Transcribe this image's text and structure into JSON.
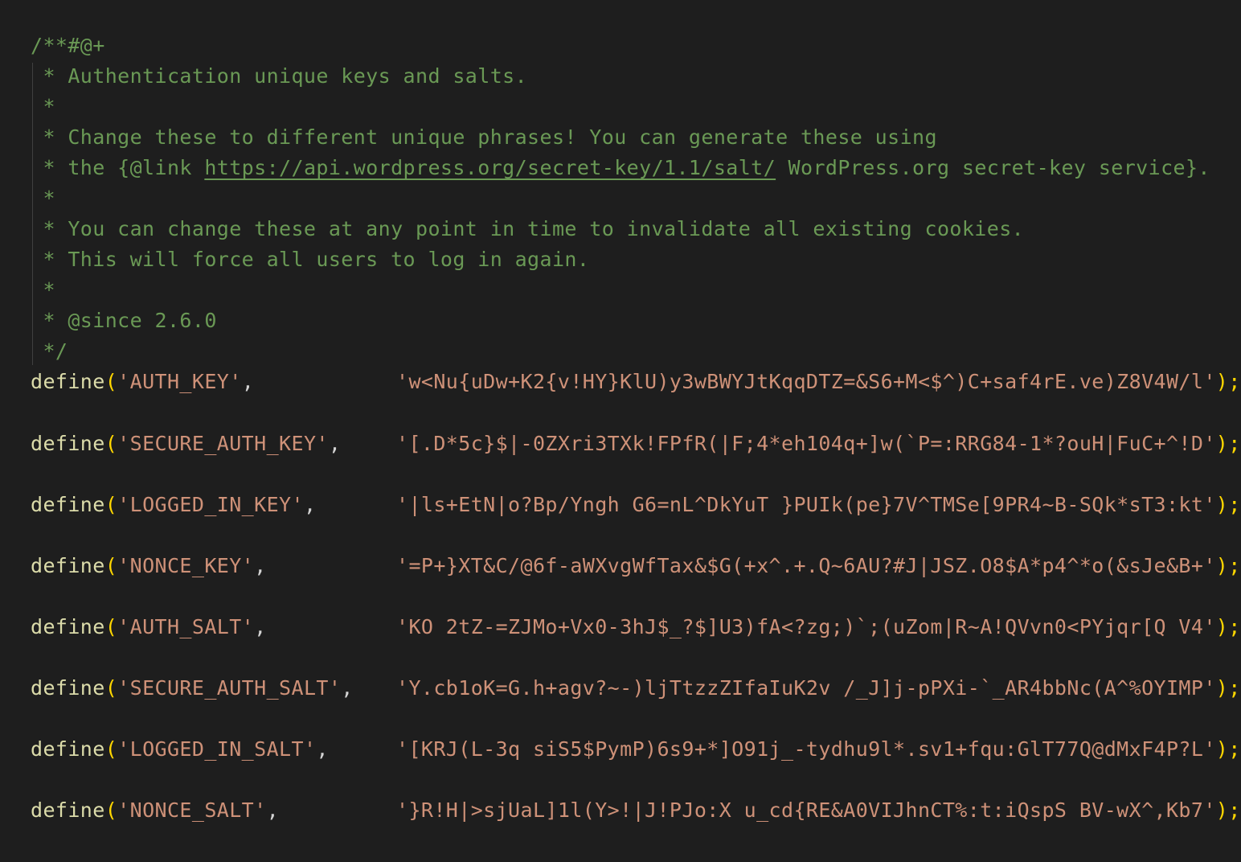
{
  "comment": {
    "open": "/**#@+",
    "title": " * Authentication unique keys and salts.",
    "blank1": " *",
    "change_a": " * Change these to different unique phrases! You can generate these using",
    "link_prefix": " * the {@link ",
    "link_url": "https://api.wordpress.org/secret-key/1.1/salt/",
    "link_suffix": " WordPress.org secret-key service}.",
    "blank2": " *",
    "invalidate": " * You can change these at any point in time to invalidate all existing cookies.",
    "force": " * This will force all users to log in again.",
    "blank3": " *",
    "since": " * @since 2.6.0",
    "close": " */"
  },
  "defines": [
    {
      "fn": "define",
      "key": "'AUTH_KEY'",
      "value": "'w<Nu{uDw+K2{v!HY}KlU)y3wBWYJtKqqDTZ=&S6+M<$^)C+saf4rE.ve)Z8V4W/l'"
    },
    {
      "fn": "define",
      "key": "'SECURE_AUTH_KEY'",
      "value": "'[.D*5c}$|-0ZXri3TXk!FPfR(|F;4*eh104q+]w(`P=:RRG84-1*?ouH|FuC+^!D'"
    },
    {
      "fn": "define",
      "key": "'LOGGED_IN_KEY'",
      "value": "'|ls+EtN|o?Bp/Yngh G6=nL^DkYuT }PUIk(pe}7V^TMSe[9PR4~B-SQk*sT3:kt'"
    },
    {
      "fn": "define",
      "key": "'NONCE_KEY'",
      "value": "'=P+}XT&C/@6f-aWXvgWfTax&$G(+x^.+.Q~6AU?#J|JSZ.O8$A*p4^*o(&sJe&B+'"
    },
    {
      "fn": "define",
      "key": "'AUTH_SALT'",
      "value": "'KO 2tZ-=ZJMo+Vx0-3hJ$_?$]U3)fA<?zg;)`;(uZom|R~A!QVvn0<PYjqr[Q V4'"
    },
    {
      "fn": "define",
      "key": "'SECURE_AUTH_SALT'",
      "value": "'Y.cb1oK=G.h+agv?~-)ljTtzzZIfaIuK2v /_J]j-pPXi-`_AR4bbNc(A^%OYIMP'"
    },
    {
      "fn": "define",
      "key": "'LOGGED_IN_SALT'",
      "value": "'[KRJ(L-3q siS5$PymP)6s9+*]O91j_-tydhu9l*.sv1+fqu:GlT77Q@dMxF4P?L'"
    },
    {
      "fn": "define",
      "key": "'NONCE_SALT'",
      "value": "'}R!H|>sjUaL]1l(Y>!|J!PJo:X u_cd{RE&A0VIJhnCT%:t:iQspS BV-wX^,Kb7'"
    }
  ],
  "punct": {
    "open_paren": "(",
    "comma": ",",
    "close": ");"
  },
  "colors": {
    "background": "#1e1e1e",
    "comment": "#6a9955",
    "function": "#dcdcaa",
    "bracket": "#ffd700",
    "string": "#ce9178"
  }
}
